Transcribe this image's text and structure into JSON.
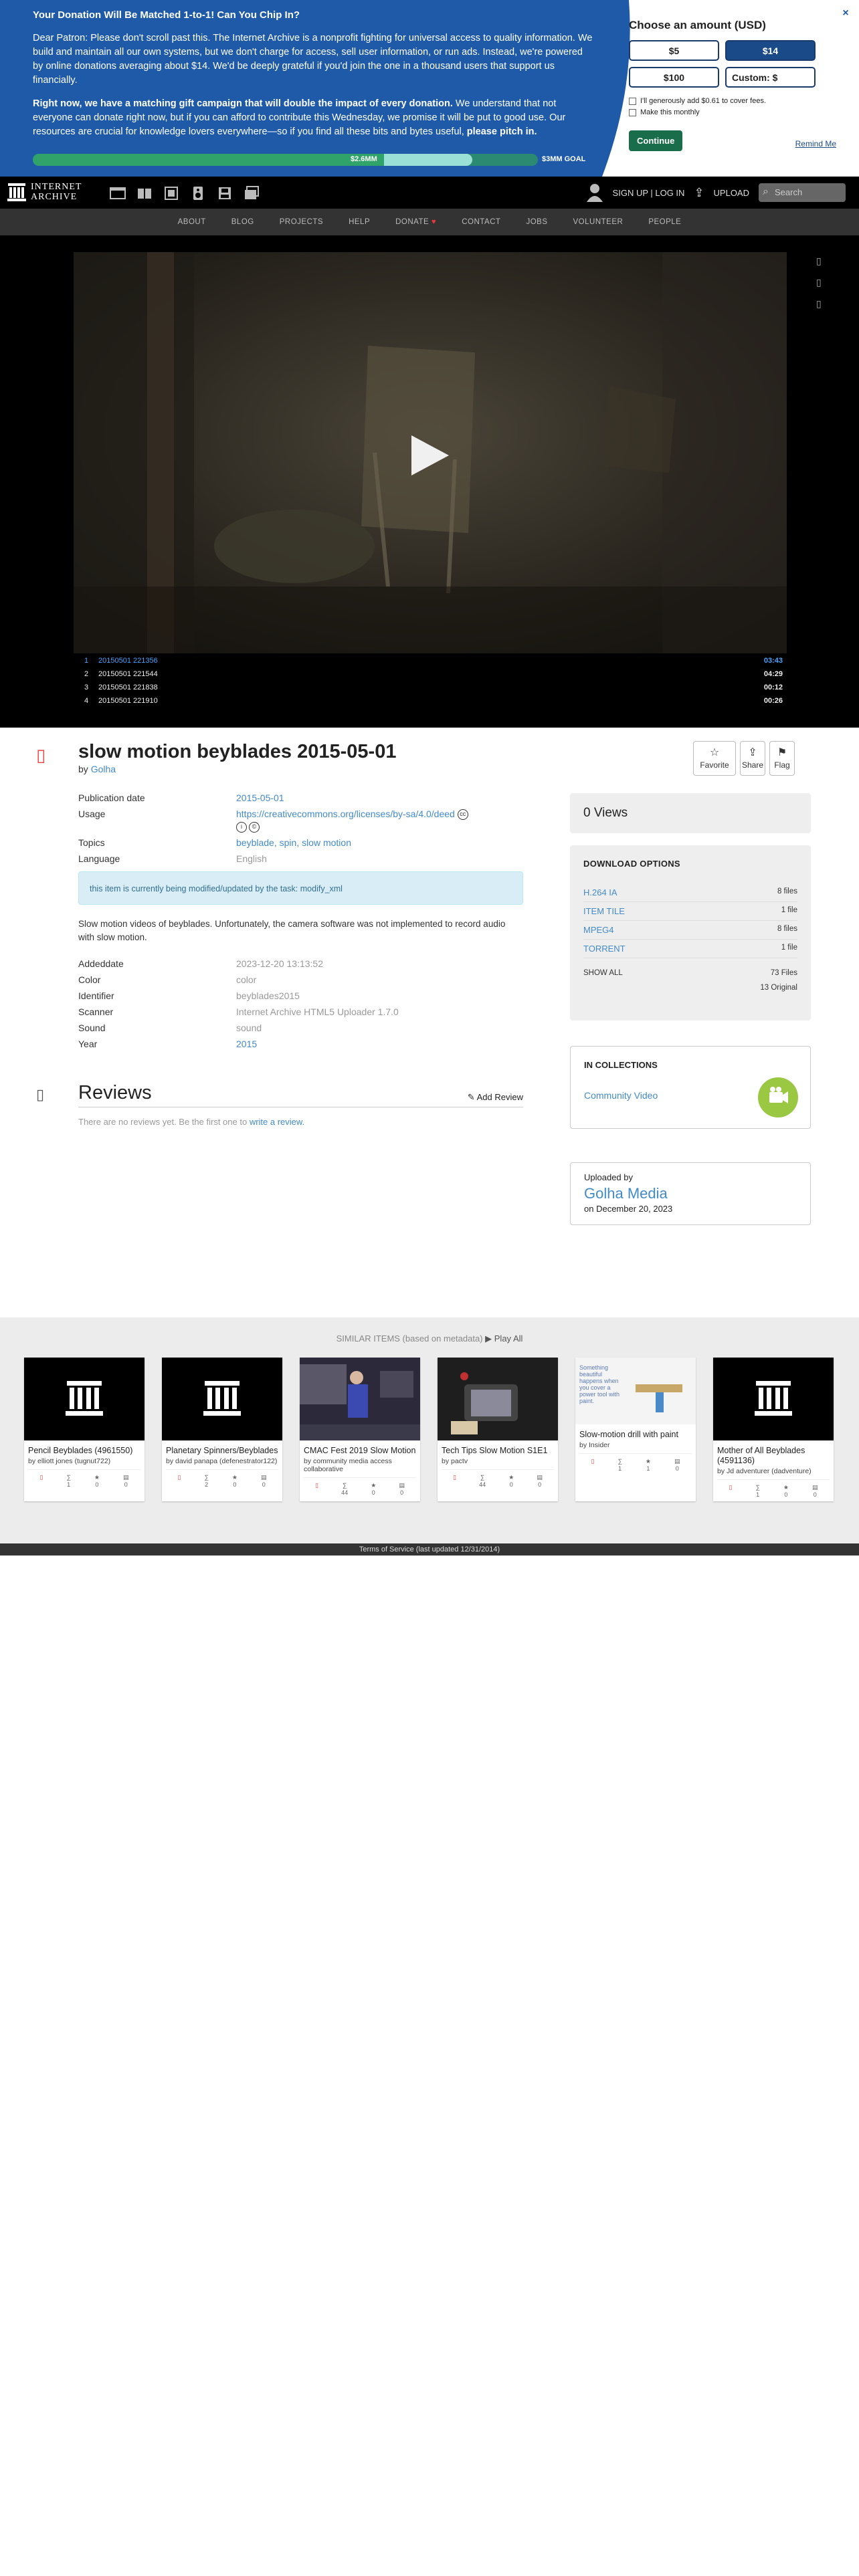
{
  "donation": {
    "heading": "Your Donation Will Be Matched 1-to-1! Can You Chip In?",
    "p1": "Dear Patron: Please don't scroll past this. The Internet Archive is a nonprofit fighting for universal access to quality information. We build and maintain all our own systems, but we don't charge for access, sell user information, or run ads. Instead, we're powered by online donations averaging about $14. We'd be deeply grateful if you'd join the one in a thousand users that support us financially.",
    "p2_bold": "Right now, we have a matching gift campaign that will double the impact of every donation.",
    "p2_rest": " We understand that not everyone can donate right now, but if you can afford to contribute this Wednesday, we promise it will be put to good use. Our resources are crucial for knowledge lovers everywhere—so if you find all these bits and bytes useful, ",
    "p2_end": "please pitch in.",
    "raised": "$2.6MM",
    "goal": "$3MM GOAL",
    "progress_fraction": 0.87,
    "panel_title": "Choose an amount (USD)",
    "amounts": [
      "$5",
      "$14",
      "$100",
      "Custom: $"
    ],
    "selected_amount": "$14",
    "fee_check": "I'll generously add $0.61 to cover fees.",
    "monthly_check": "Make this monthly",
    "continue": "Continue",
    "remind": "Remind Me",
    "colors": {
      "banner": "#1e5aa8",
      "continue": "#1a6d4b"
    }
  },
  "nav": {
    "logo_line1": "INTERNET",
    "logo_line2": "ARCHIVE",
    "media_icons": [
      "web-icon",
      "texts-icon",
      "video-icon",
      "audio-icon",
      "software-icon",
      "images-icon"
    ],
    "signup": "SIGN UP | LOG IN",
    "upload": "UPLOAD",
    "search_placeholder": "Search",
    "sub": [
      "ABOUT",
      "BLOG",
      "PROJECTS",
      "HELP",
      "DONATE",
      "CONTACT",
      "JOBS",
      "VOLUNTEER",
      "PEOPLE"
    ]
  },
  "playlist": [
    {
      "n": "1",
      "name": "20150501 221356",
      "dur": "03:43"
    },
    {
      "n": "2",
      "name": "20150501 221544",
      "dur": "04:29"
    },
    {
      "n": "3",
      "name": "20150501 221838",
      "dur": "00:12"
    },
    {
      "n": "4",
      "name": "20150501 221910",
      "dur": "00:26"
    }
  ],
  "item": {
    "title": "slow motion beyblades 2015-05-01",
    "by_label": "by",
    "by": "Golha",
    "actions": [
      "Favorite",
      "Share",
      "Flag"
    ],
    "meta": [
      {
        "k": "Publication date",
        "v": "2015-05-01"
      },
      {
        "k": "Usage",
        "v": "https://creativecommons.org/licenses/by-sa/4.0/deed"
      },
      {
        "k": "Topics",
        "v": "beyblade, spin, slow motion"
      },
      {
        "k": "Language",
        "v": "English"
      }
    ],
    "notice": "this item is currently being modified/updated by the task: modify_xml",
    "description": "Slow motion videos of beyblades. Unfortunately, the camera software was not implemented to record audio with slow motion.",
    "meta2": [
      {
        "k": "Addeddate",
        "v": "2023-12-20 13:13:52"
      },
      {
        "k": "Color",
        "v": "color"
      },
      {
        "k": "Identifier",
        "v": "beyblades2015"
      },
      {
        "k": "Scanner",
        "v": "Internet Archive HTML5 Uploader 1.7.0"
      },
      {
        "k": "Sound",
        "v": "sound"
      },
      {
        "k": "Year",
        "v": "2015"
      }
    ],
    "reviews_title": "Reviews",
    "add_review": "Add Review",
    "no_reviews": "There are no reviews yet. Be the first one to",
    "write_review": "write a review."
  },
  "sidebar": {
    "views": "0 Views",
    "download_title": "DOWNLOAD OPTIONS",
    "files": [
      {
        "name": "H.264 IA",
        "count": "8 files"
      },
      {
        "name": "ITEM TILE",
        "count": "1 file"
      },
      {
        "name": "MPEG4",
        "count": "8 files"
      },
      {
        "name": "TORRENT",
        "count": "1 file"
      }
    ],
    "show_all": "SHOW ALL",
    "total_files": "73 Files",
    "original": "13 Original",
    "collections_title": "IN COLLECTIONS",
    "collection": "Community Video",
    "uploaded_by_label": "Uploaded by",
    "uploader": "Golha Media",
    "uploaded_on": "on December 20, 2023"
  },
  "similar": {
    "header": "SIMILAR ITEMS (based on metadata)",
    "play_all": "Play All",
    "items": [
      {
        "title": "Pencil Beyblades (4961550)",
        "by": "by elliott jones (tugnut722)",
        "stats": [
          "1",
          "0",
          "0"
        ]
      },
      {
        "title": "Planetary Spinners/Beyblades",
        "by": "by david panapa (defenestrator122)",
        "stats": [
          "2",
          "0",
          "0"
        ]
      },
      {
        "title": "CMAC Fest 2019 Slow Motion",
        "by": "by community media access collaborative",
        "stats": [
          "44",
          "0",
          "0"
        ]
      },
      {
        "title": "Tech Tips Slow Motion S1E1",
        "by": "by pactv",
        "stats": [
          "44",
          "0",
          "0"
        ]
      },
      {
        "title": "Slow-motion drill with paint",
        "by": "by Insider",
        "stats": [
          "1",
          "1",
          "0"
        ]
      },
      {
        "title": "Mother of All Beyblades (4591136)",
        "by": "by Jd adventurer (dadventure)",
        "stats": [
          "1",
          "0",
          "0"
        ]
      }
    ],
    "thumb_text": "Something beautiful happens when you cover a power tool with paint."
  },
  "footer": "Terms of Service (last updated 12/31/2014)"
}
